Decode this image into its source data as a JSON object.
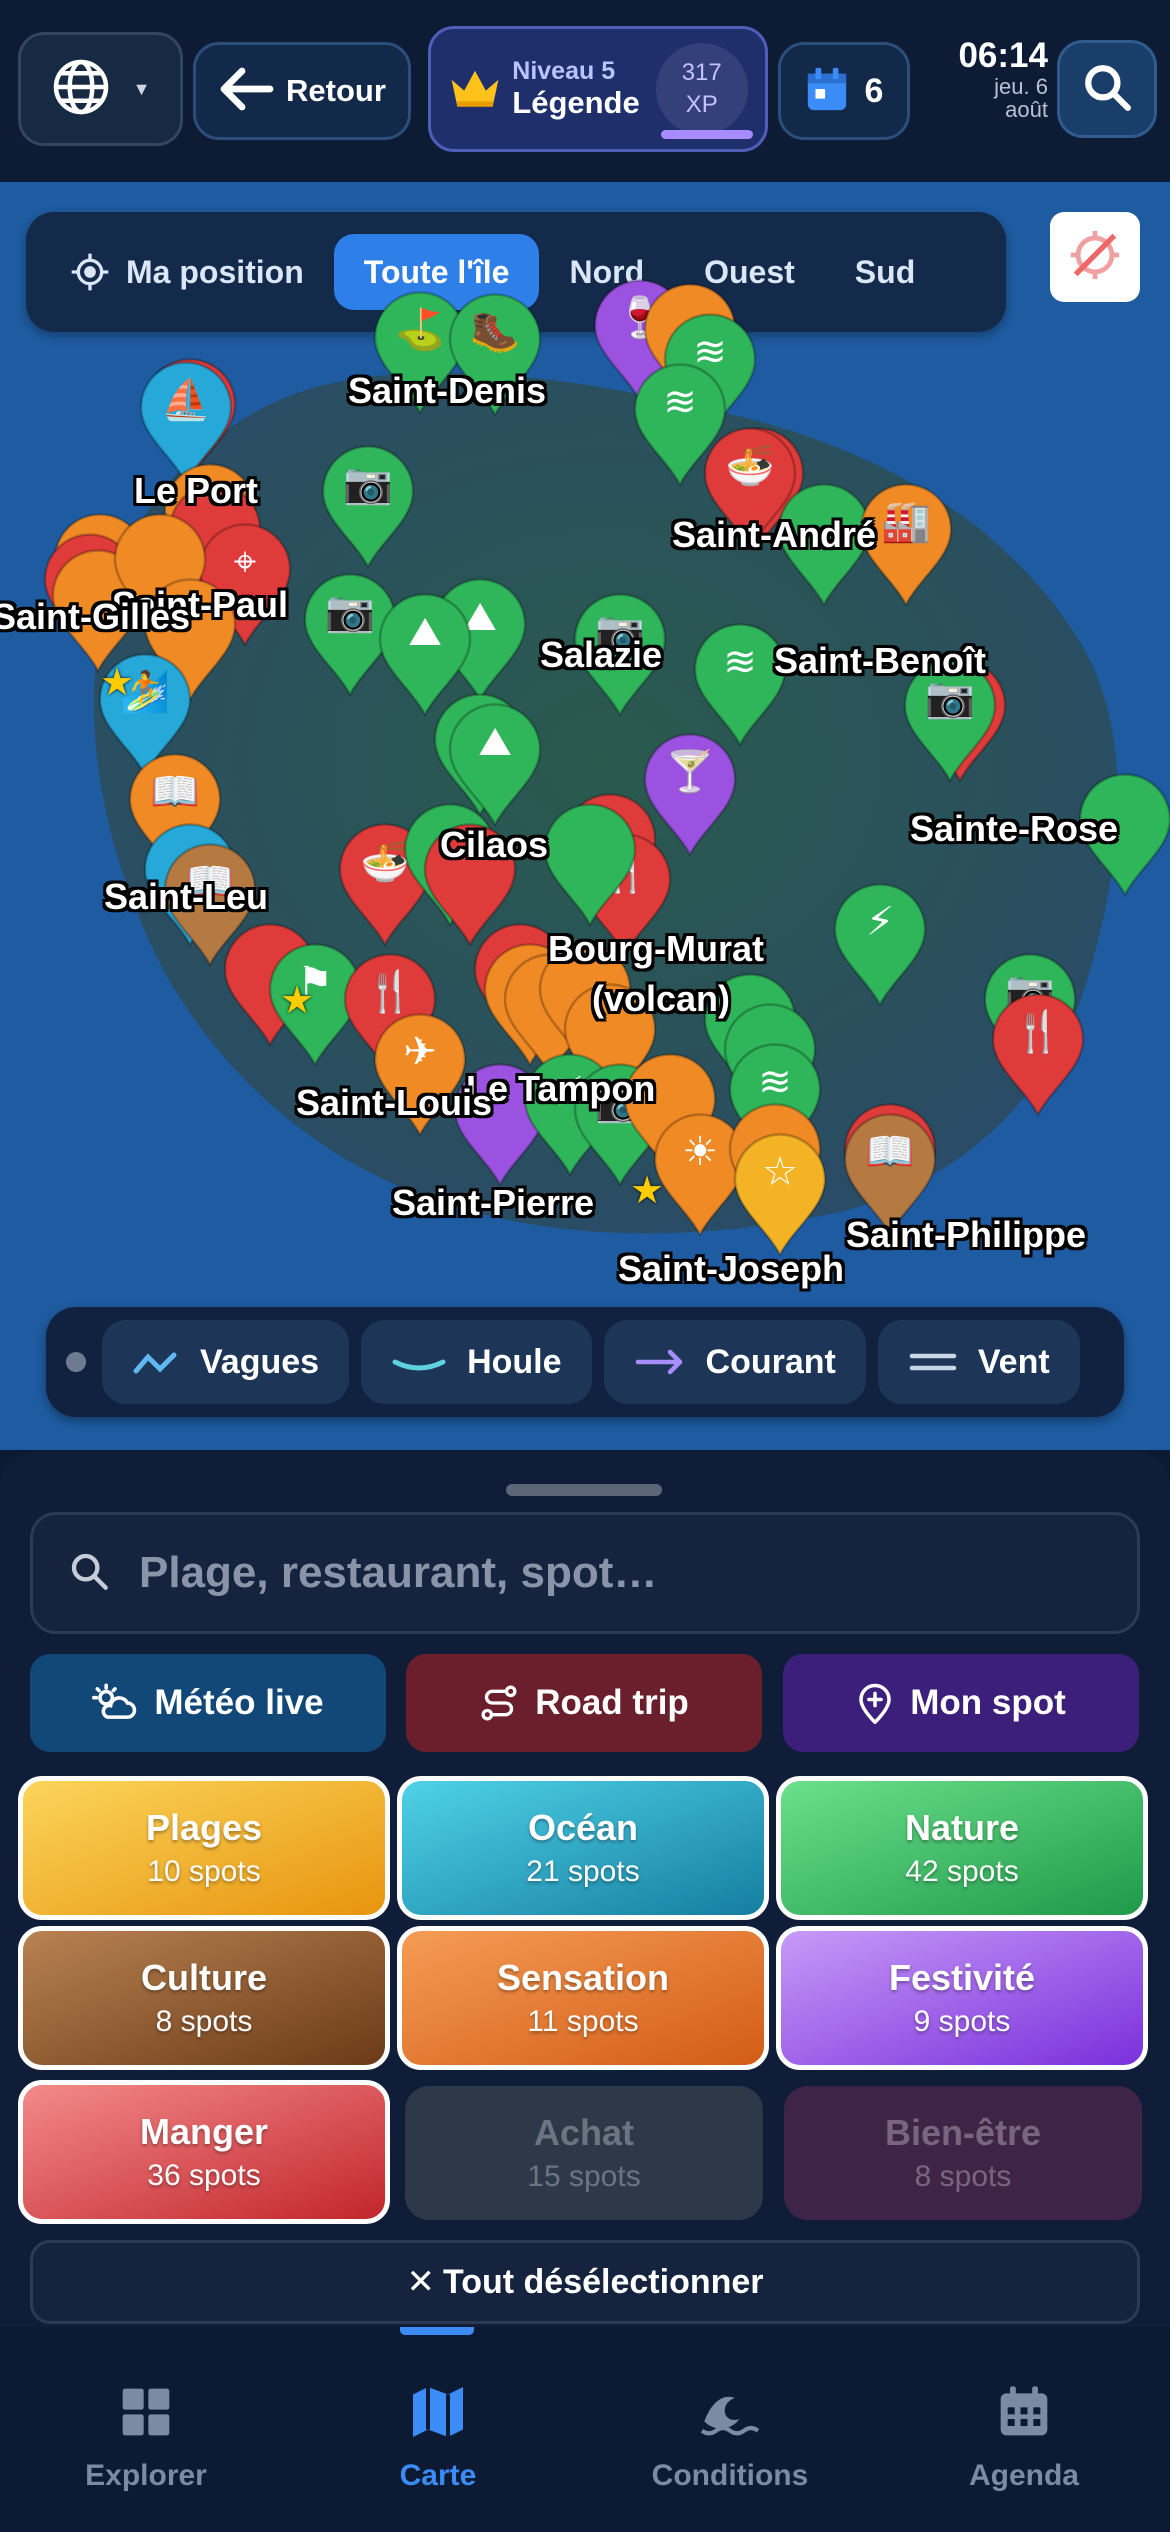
{
  "topbar": {
    "back_label": "Retour",
    "level_label": "Niveau 5",
    "level_title": "Légende",
    "xp_value": "317",
    "xp_unit": "XP",
    "agenda_count": "6",
    "time": "06:14",
    "date_line1": "jeu. 6",
    "date_line2": "août"
  },
  "map": {
    "region_tabs": [
      {
        "label": "Ma position",
        "active": false
      },
      {
        "label": "Toute l'île",
        "active": true
      },
      {
        "label": "Nord",
        "active": false
      },
      {
        "label": "Ouest",
        "active": false
      },
      {
        "label": "Sud",
        "active": false
      }
    ],
    "cities": [
      "Saint-Denis",
      "Le Port",
      "Saint-Paul",
      "Saint-Gilles",
      "Saint-André",
      "Salazie",
      "Saint-Benoît",
      "Cilaos",
      "Sainte-Rose",
      "Saint-Leu",
      "Bourg-Murat",
      "(volcan)",
      "Le Tampon",
      "Saint-Louis",
      "Saint-Pierre",
      "Saint-Joseph",
      "Saint-Philippe"
    ],
    "layers": [
      {
        "label": "Vagues",
        "icon": "wave-icon"
      },
      {
        "label": "Houle",
        "icon": "swell-icon"
      },
      {
        "label": "Courant",
        "icon": "arrow-right-icon"
      },
      {
        "label": "Vent",
        "icon": "wind-icon"
      }
    ],
    "colors": {
      "green": "#2fb55a",
      "red": "#e03b3b",
      "orange": "#f08a24",
      "yellow": "#f4b324",
      "cyan": "#26a8d8",
      "purple": "#9b52e0",
      "brown": "#b57a42"
    }
  },
  "sheet": {
    "search_placeholder": "Plage, restaurant, spot…",
    "actions": [
      {
        "label": "Météo live",
        "color": "#134a7c",
        "icon": "weather-icon"
      },
      {
        "label": "Road trip",
        "color": "#6b1f2c",
        "icon": "route-icon"
      },
      {
        "label": "Mon spot",
        "color": "#3b1f7a",
        "icon": "pin-plus-icon"
      }
    ],
    "categories": [
      {
        "name": "Plages",
        "count": "10 spots"
      },
      {
        "name": "Océan",
        "count": "21 spots"
      },
      {
        "name": "Nature",
        "count": "42 spots"
      },
      {
        "name": "Culture",
        "count": "8 spots"
      },
      {
        "name": "Sensation",
        "count": "11 spots"
      },
      {
        "name": "Festivité",
        "count": "9 spots"
      },
      {
        "name": "Manger",
        "count": "36 spots"
      },
      {
        "name": "Achat",
        "count": "15 spots"
      },
      {
        "name": "Bien-être",
        "count": "8 spots"
      }
    ],
    "deselect_label": "Tout désélectionner"
  },
  "tabs": [
    {
      "label": "Explorer",
      "icon": "grid-icon",
      "active": false
    },
    {
      "label": "Carte",
      "icon": "map-icon",
      "active": true
    },
    {
      "label": "Conditions",
      "icon": "waves-icon",
      "active": false
    },
    {
      "label": "Agenda",
      "icon": "calendar-icon",
      "active": false
    }
  ]
}
